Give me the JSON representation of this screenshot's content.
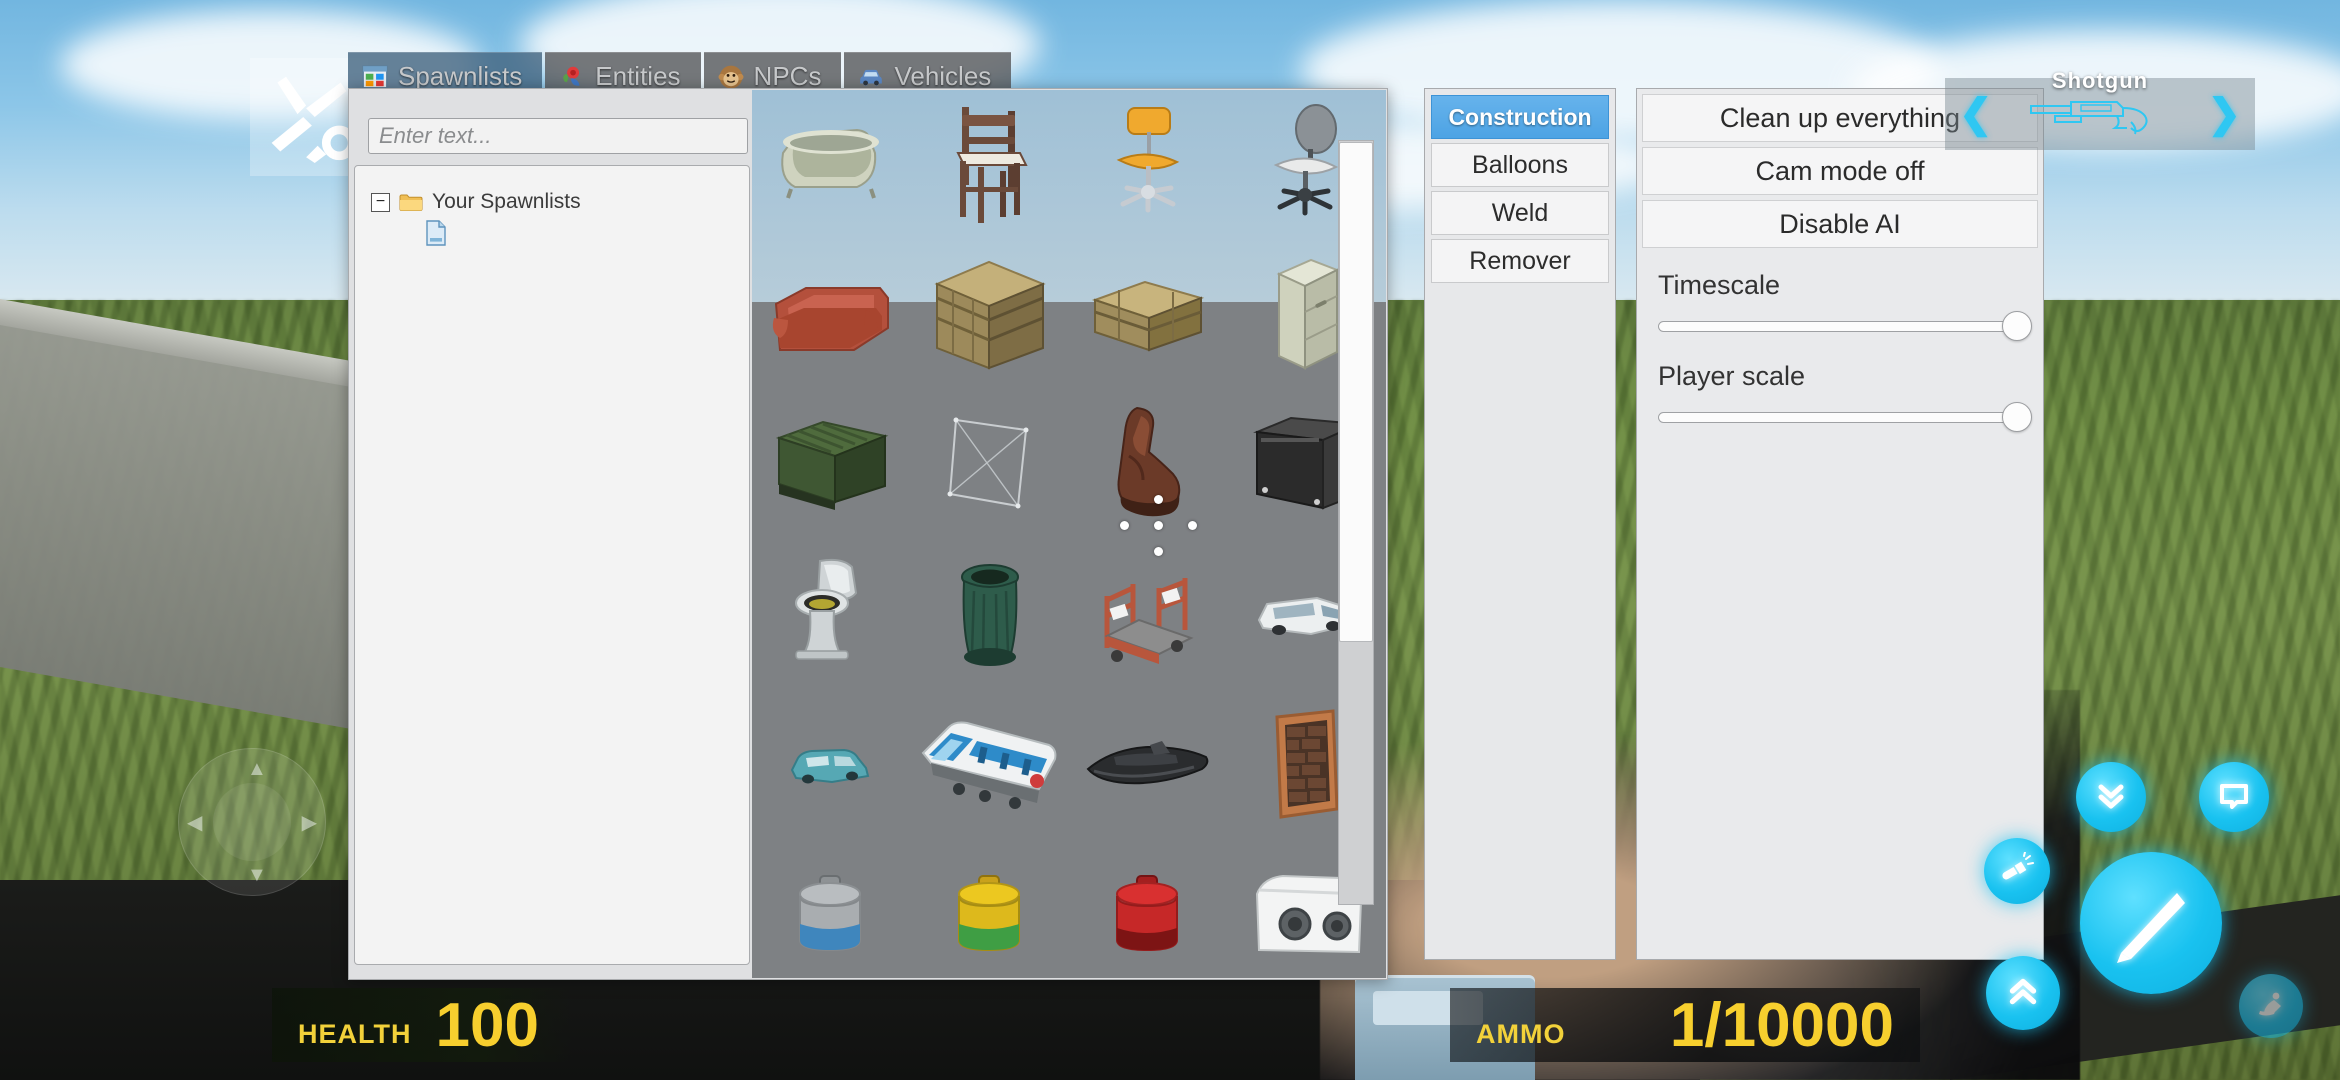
{
  "window": {
    "tool_icon": "wrench-screwdriver-icon"
  },
  "tabs": [
    {
      "label": "Spawnlists",
      "icon": "grid-palette-icon",
      "active": true
    },
    {
      "label": "Entities",
      "icon": "rose-flower-icon",
      "active": false
    },
    {
      "label": "NPCs",
      "icon": "monkey-face-icon",
      "active": false
    },
    {
      "label": "Vehicles",
      "icon": "car-icon",
      "active": false
    }
  ],
  "search": {
    "value": "",
    "placeholder": "Enter text..."
  },
  "tree": {
    "root": {
      "label": "Your Spawnlists",
      "expander": "−",
      "icon": "folder-icon"
    },
    "child": {
      "label": "",
      "icon": "file-icon"
    }
  },
  "grid": {
    "items": [
      {
        "name": "bathtub"
      },
      {
        "name": "wooden-chair"
      },
      {
        "name": "orange-office-chair"
      },
      {
        "name": "grey-office-chair"
      },
      {
        "name": "red-sofa"
      },
      {
        "name": "large-wooden-crate"
      },
      {
        "name": "small-wooden-crate"
      },
      {
        "name": "filing-cabinet"
      },
      {
        "name": "green-dumpster"
      },
      {
        "name": "wire-frame-panel"
      },
      {
        "name": "leather-boot"
      },
      {
        "name": "black-suitcase"
      },
      {
        "name": "toilet"
      },
      {
        "name": "green-trash-can"
      },
      {
        "name": "utility-cart"
      },
      {
        "name": "white-van"
      },
      {
        "name": "blue-car"
      },
      {
        "name": "passenger-train"
      },
      {
        "name": "black-boat"
      },
      {
        "name": "brick-wall-panel"
      },
      {
        "name": "grey-gas-canister"
      },
      {
        "name": "yellow-gas-canister"
      },
      {
        "name": "red-gas-canister"
      },
      {
        "name": "white-machine"
      }
    ],
    "scroll_thumb_percent": 66
  },
  "tools": {
    "items": [
      {
        "label": "Construction",
        "selected": true
      },
      {
        "label": "Balloons",
        "selected": false
      },
      {
        "label": "Weld",
        "selected": false
      },
      {
        "label": "Remover",
        "selected": false
      }
    ]
  },
  "options": {
    "buttons": [
      {
        "label": "Clean up everything"
      },
      {
        "label": "Cam mode off"
      },
      {
        "label": "Disable AI"
      }
    ],
    "sliders": [
      {
        "label": "Timescale",
        "value_percent": 95
      },
      {
        "label": "Player scale",
        "value_percent": 95
      }
    ]
  },
  "hud": {
    "health": {
      "label": "HEALTH",
      "value": "100"
    },
    "ammo": {
      "label": "AMMO",
      "value": "1/10000"
    }
  },
  "weapon_selector": {
    "name": "Shotgun",
    "prev_arrow": "❮",
    "next_arrow": "❯",
    "icon": "shotgun-outline-icon"
  },
  "touch_controls": {
    "joystick": {
      "name": "movement-joystick",
      "up": "▲",
      "down": "▼",
      "left": "◀",
      "right": "▶"
    },
    "buttons": [
      {
        "name": "crouch-button",
        "icon": "double-chevron-down-icon"
      },
      {
        "name": "chat-button",
        "icon": "speech-bubble-icon"
      },
      {
        "name": "flashlight-button",
        "icon": "flashlight-icon"
      },
      {
        "name": "attack-button",
        "icon": "melee-slash-icon"
      },
      {
        "name": "jump-button",
        "icon": "double-chevron-up-icon"
      },
      {
        "name": "noclip-button",
        "icon": "fly-person-icon"
      }
    ]
  },
  "colors": {
    "accent_cyan": "#19c2f0",
    "hud_yellow": "#f7cf2e",
    "selected_blue": "#4da3e4"
  }
}
